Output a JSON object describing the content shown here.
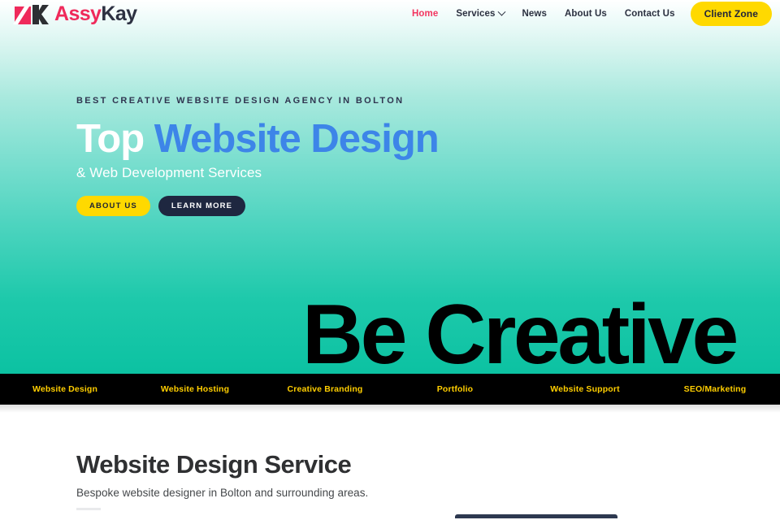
{
  "brand": {
    "name_first": "Assy",
    "name_second": "Kay",
    "logo_icon": "assykay-logo-icon"
  },
  "nav": {
    "items": [
      {
        "label": "Home",
        "active": true,
        "has_dropdown": false
      },
      {
        "label": "Services",
        "active": false,
        "has_dropdown": true,
        "dropdown_icon": "chevron-down-icon"
      },
      {
        "label": "News",
        "active": false,
        "has_dropdown": false
      },
      {
        "label": "About Us",
        "active": false,
        "has_dropdown": false
      },
      {
        "label": "Contact Us",
        "active": false,
        "has_dropdown": false
      }
    ],
    "cta_label": "Client Zone"
  },
  "hero": {
    "eyebrow": "BEST CREATIVE WEBSITE DESIGN AGENCY IN BOLTON",
    "headline_white": "Top ",
    "headline_blue": "Website Design",
    "subline": "& Web Development Services",
    "buttons": {
      "primary_label": "ABOUT US",
      "secondary_label": "LEARN MORE"
    },
    "watermark": "Be Creative"
  },
  "service_strip": {
    "items": [
      {
        "label": "Website Design"
      },
      {
        "label": "Website Hosting"
      },
      {
        "label": "Creative Branding"
      },
      {
        "label": "Portfolio"
      },
      {
        "label": "Website Support"
      },
      {
        "label": "SEO/Marketing"
      }
    ]
  },
  "section": {
    "title": "Website Design Service",
    "subtitle": "Bespoke website designer in Bolton and surrounding areas."
  },
  "colors": {
    "accent_pink": "#ef2a5b",
    "accent_yellow": "#ffd900",
    "strip_yellow": "#ffce00",
    "headline_blue": "#3d85e8",
    "dark_navy": "#1e2740",
    "teal_bottom": "#0cc2a2",
    "black": "#000000"
  }
}
